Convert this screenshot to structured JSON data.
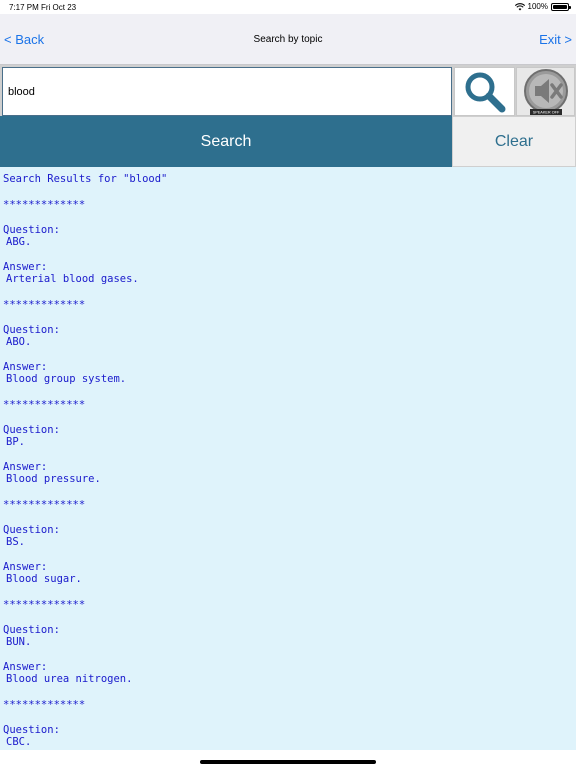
{
  "status_bar": {
    "time": "7:17 PM",
    "date": "Fri Oct 23",
    "battery": "100%"
  },
  "nav": {
    "back_label": "< Back",
    "title": "Search by topic",
    "exit_label": "Exit >"
  },
  "search": {
    "value": "blood",
    "speaker_label": "SPEAKER OFF"
  },
  "buttons": {
    "search_label": "Search",
    "clear_label": "Clear"
  },
  "results": {
    "header": "Search Results for  \"blood\"",
    "separator": "*************",
    "question_label": "Question:",
    "answer_label": "Answer:",
    "entries": [
      {
        "question": "ABG.",
        "answer": "Arterial blood gases."
      },
      {
        "question": "ABO.",
        "answer": "Blood group system."
      },
      {
        "question": "BP.",
        "answer": "Blood pressure."
      },
      {
        "question": "BS.",
        "answer": "Blood sugar."
      },
      {
        "question": "BUN.",
        "answer": "Blood urea nitrogen."
      },
      {
        "question": "CBC.",
        "answer": ""
      }
    ]
  },
  "colors": {
    "accent": "#2e6f8e",
    "link": "#1a73e8",
    "results_bg": "#dff3fb",
    "results_text": "#1a1acc"
  }
}
